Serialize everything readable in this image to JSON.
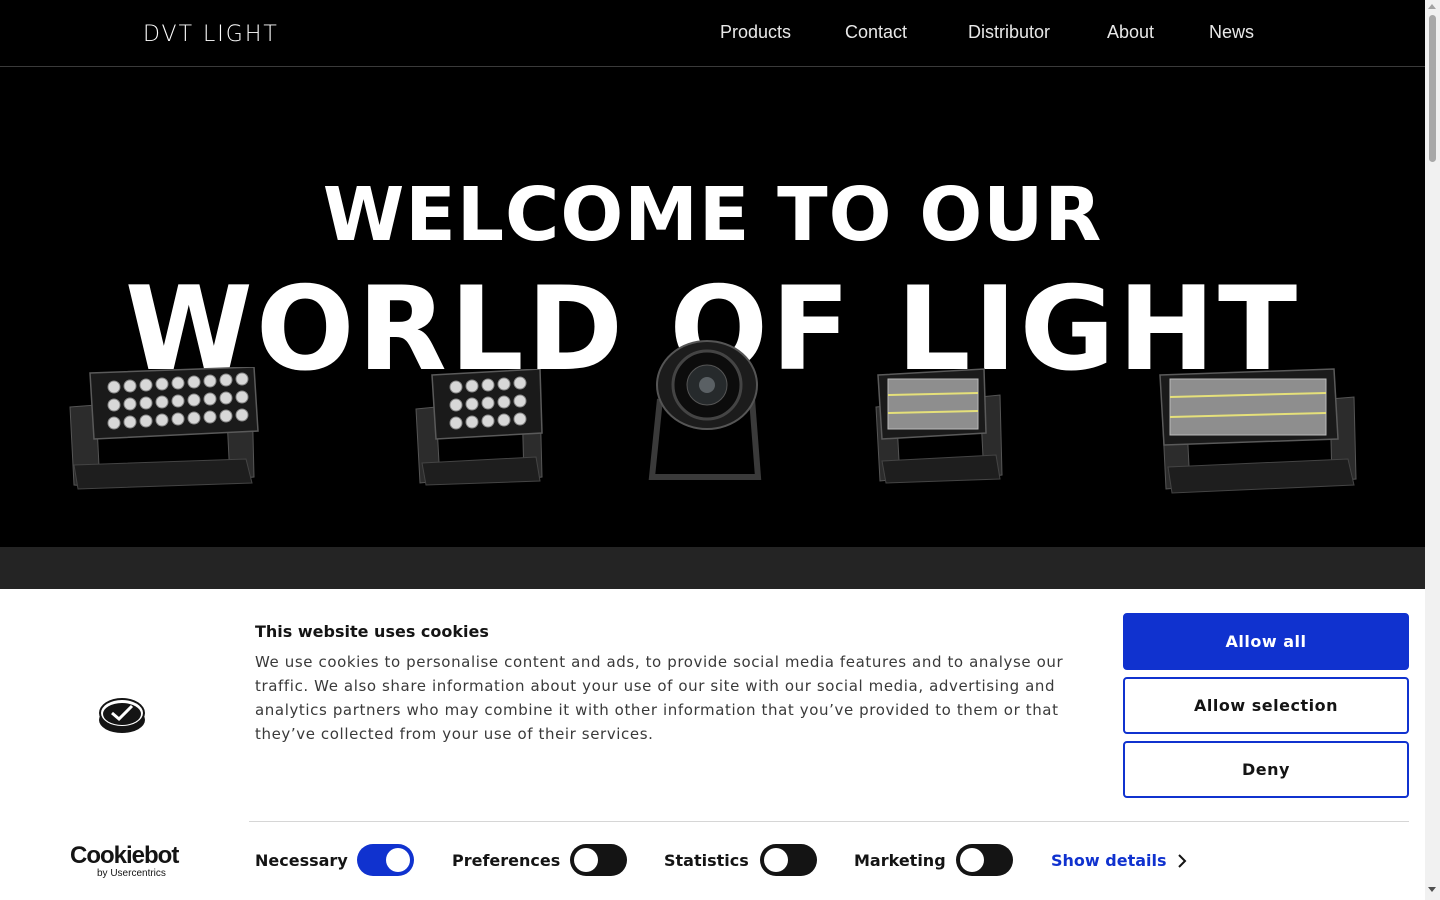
{
  "header": {
    "logo": "DVT LIGHT",
    "nav": [
      "Products",
      "Contact",
      "Distributor",
      "About",
      "News"
    ]
  },
  "hero": {
    "line1": "WELCOME TO OUR",
    "line2": "WORLD OF LIGHT"
  },
  "cookie_banner": {
    "title": "This website uses cookies",
    "text": "We use cookies to personalise content and ads, to provide social media features and to analyse our traffic. We also share information about your use of our site with our social media, advertising and analytics partners who may combine it with other information that you’ve provided to them or that they’ve collected from your use of their services.",
    "buttons": {
      "allow_all": "Allow all",
      "allow_selection": "Allow selection",
      "deny": "Deny"
    },
    "brand": {
      "name": "Cookiebot",
      "sub": "by Usercentrics"
    },
    "toggles": [
      {
        "label": "Necessary",
        "on": true
      },
      {
        "label": "Preferences",
        "on": false
      },
      {
        "label": "Statistics",
        "on": false
      },
      {
        "label": "Marketing",
        "on": false
      }
    ],
    "show_details": "Show details"
  },
  "colors": {
    "accent": "#1032cf",
    "background": "#000000",
    "band": "#242424"
  },
  "icons": [
    "cookiebot-logo-icon",
    "chevron-right-icon",
    "scroll-up-arrow-icon",
    "scroll-down-arrow-icon"
  ]
}
